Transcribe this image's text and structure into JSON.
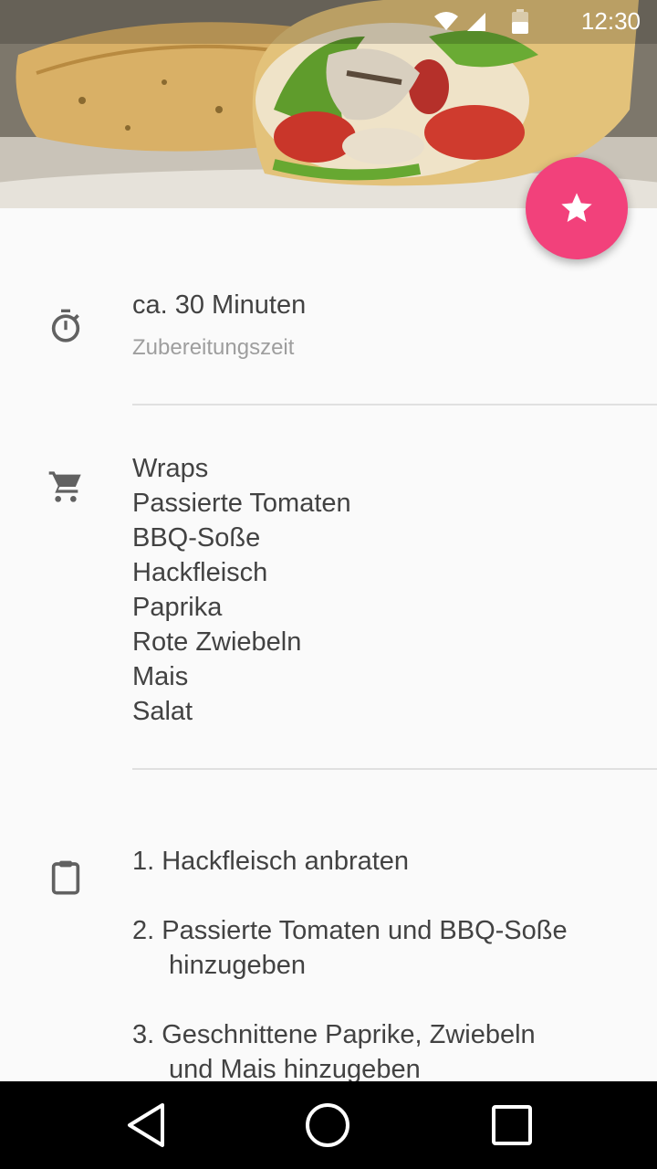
{
  "status_bar": {
    "time": "12:30",
    "icons": [
      "wifi-icon",
      "signal-icon",
      "battery-icon"
    ]
  },
  "hero": {
    "image": "chicken-caesar-wrap-photo"
  },
  "fab": {
    "icon": "star-icon",
    "color": "#f2417b"
  },
  "prep": {
    "time": "ca. 30 Minuten",
    "label": "Zubereitungszeit",
    "icon": "timer-icon"
  },
  "ingredients": {
    "icon": "cart-icon",
    "items": [
      "Wraps",
      "Passierte Tomaten",
      "BBQ-Soße",
      "Hackfleisch",
      "Paprika",
      "Rote Zwiebeln",
      "Mais",
      "Salat"
    ]
  },
  "steps": {
    "icon": "clipboard-icon",
    "items": [
      {
        "first": "1. Hackfleisch anbraten",
        "rest": ""
      },
      {
        "first": "2. Passierte Tomaten und BBQ-Soße",
        "rest": "hinzugeben"
      },
      {
        "first": "3. Geschnittene Paprike, Zwiebeln",
        "rest": "und Mais hinzugeben"
      }
    ]
  },
  "nav": {
    "back": "back-icon",
    "home": "home-icon",
    "recents": "recents-icon"
  }
}
